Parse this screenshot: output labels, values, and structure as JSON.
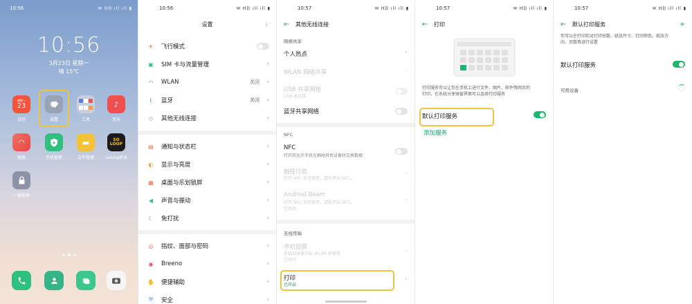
{
  "colors": {
    "accent": "#1fb56c",
    "highlight": "#f0c43a"
  },
  "status": {
    "p1_time": "10:56",
    "p2_time": "10:56",
    "p3_time": "10:57",
    "p4_time": "10:57",
    "p5_time": "10:57",
    "icons": "✉ HD ıll ıll ▮"
  },
  "home": {
    "clock": "10:56",
    "date_line": "3月23日 星期一",
    "weather": "晴 15℃",
    "calendar_day": "23",
    "calendar_weekday": "星期一",
    "apps": [
      {
        "label": "日历"
      },
      {
        "label": "设置"
      },
      {
        "label": "工具"
      },
      {
        "label": "音乐"
      },
      {
        "label": "相册"
      },
      {
        "label": "手机管家"
      },
      {
        "label": "文件管理"
      },
      {
        "label": "Soloop即录"
      },
      {
        "label": "一键锁屏"
      }
    ],
    "soloop_text": "SO LOOP"
  },
  "settings": {
    "title": "设置",
    "items": [
      {
        "label": "飞行模式"
      },
      {
        "label": "SIM 卡与流量管理"
      },
      {
        "label": "WLAN",
        "value": "关闭"
      },
      {
        "label": "蓝牙",
        "value": "关闭"
      },
      {
        "label": "其他无线连接"
      },
      {
        "label": "通知与状态栏"
      },
      {
        "label": "显示与亮度"
      },
      {
        "label": "桌面与乐划锁屏"
      },
      {
        "label": "声音与振动"
      },
      {
        "label": "免打扰"
      },
      {
        "label": "指纹、面部与密码"
      },
      {
        "label": "Breeno"
      },
      {
        "label": "便捷辅助"
      },
      {
        "label": "安全"
      }
    ]
  },
  "wireless": {
    "title": "其他无线连接",
    "section_share": "网络共享",
    "hotspot": "个人热点",
    "wlan_share": "WLAN 网络共享",
    "usb_share": "USB 共享网络",
    "usb_sub": "USB 未连接",
    "bt_share": "蓝牙共享网络",
    "section_nfc": "NFC",
    "nfc": "NFC",
    "nfc_sub": "打开后允许手机在触碰其他设备时交换数据",
    "touch_pay": "触碰付款",
    "touch_pay_sub": "打开 NFC 后可使用，请先开启 NFC。",
    "beam": "Android Beam",
    "beam_sub1": "打开 NFC 后可使用，请先开启 NFC。",
    "beam_sub2": "已关闭",
    "section_wireless": "无线传输",
    "cast": "手机投屏",
    "cast_sub1": "手机投屏需开启 WLAN 后使用",
    "cast_sub2": "已关闭",
    "print": "打印",
    "print_sub": "已开启"
  },
  "print": {
    "title": "打印",
    "desc1": "打印服务可以让你在手机上进行文件、图片、邮件等网页的",
    "desc2": "打印，在系统分享弹窗界面可以选择打印服务",
    "default_service": "默认打印服务",
    "add_service": "添加服务"
  },
  "default_print": {
    "title": "默认打印服务",
    "plus": "+",
    "desc1": "你可以在打印前对打印份数、纸张尺寸、打印颜色、纸张方",
    "desc2": "向、页数等进行设置",
    "default_service": "默认打印服务",
    "available": "可用设备"
  }
}
